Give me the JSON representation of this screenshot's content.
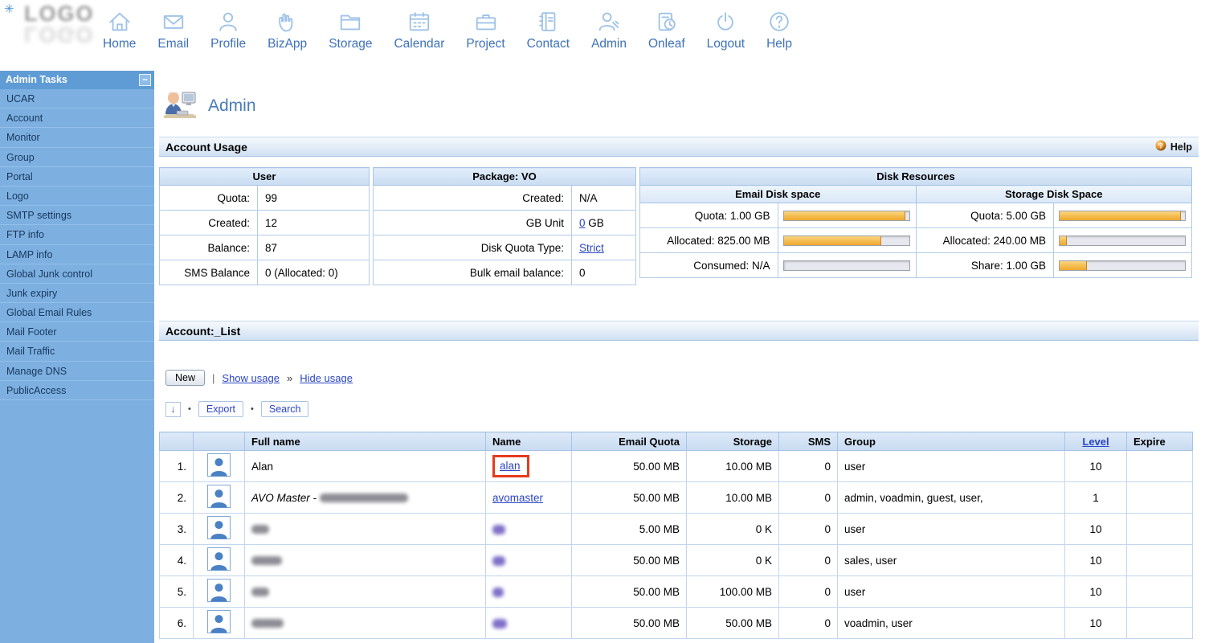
{
  "branding": {
    "mark": "✳",
    "logo_text": "LOGO"
  },
  "topnav": {
    "items": [
      {
        "label": "Home",
        "icon": "home-icon"
      },
      {
        "label": "Email",
        "icon": "email-icon"
      },
      {
        "label": "Profile",
        "icon": "profile-icon"
      },
      {
        "label": "BizApp",
        "icon": "bizapp-icon"
      },
      {
        "label": "Storage",
        "icon": "storage-icon"
      },
      {
        "label": "Calendar",
        "icon": "calendar-icon"
      },
      {
        "label": "Project",
        "icon": "project-icon"
      },
      {
        "label": "Contact",
        "icon": "contact-icon"
      },
      {
        "label": "Admin",
        "icon": "admin-icon"
      },
      {
        "label": "Onleaf",
        "icon": "onleaf-icon"
      },
      {
        "label": "Logout",
        "icon": "logout-icon"
      },
      {
        "label": "Help",
        "icon": "help-icon"
      }
    ]
  },
  "sidebar": {
    "title": "Admin Tasks",
    "collapse_label": "−",
    "items": [
      "UCAR",
      "Account",
      "Monitor",
      "Group",
      "Portal",
      "Logo",
      "SMTP settings",
      "FTP info",
      "LAMP info",
      "Global Junk control",
      "Junk expiry",
      "Global Email Rules",
      "Mail Footer",
      "Mail Traffic",
      "Manage DNS",
      "PublicAccess"
    ]
  },
  "page": {
    "title": "Admin",
    "section_usage": "Account Usage",
    "help_label": "Help",
    "section_list": "Account:_List"
  },
  "usage": {
    "user": {
      "header": "User",
      "rows": [
        {
          "label": "Quota:",
          "value": "99"
        },
        {
          "label": "Created:",
          "value": "12"
        },
        {
          "label": "Balance:",
          "value": "87"
        },
        {
          "label": "SMS Balance",
          "value": "0 (Allocated: 0)"
        }
      ]
    },
    "package": {
      "header": "Package: VO",
      "rows": [
        {
          "label": "Created:",
          "value": "N/A"
        },
        {
          "label": "GB Unit",
          "link": "0",
          "suffix": " GB"
        },
        {
          "label": "Disk Quota Type:",
          "link": "Strict"
        },
        {
          "label": "Bulk email balance:",
          "value": "0"
        }
      ]
    },
    "disk": {
      "header": "Disk Resources",
      "email": {
        "header": "Email Disk space",
        "rows": [
          {
            "label": "Quota: 1.00 GB",
            "fill_pct": 97
          },
          {
            "label": "Allocated: 825.00 MB",
            "fill_pct": 78
          },
          {
            "label": "Consumed: N/A",
            "fill_pct": 0
          }
        ]
      },
      "storage": {
        "header": "Storage Disk Space",
        "rows": [
          {
            "label": "Quota: 5.00 GB",
            "fill_pct": 97
          },
          {
            "label": "Allocated: 240.00 MB",
            "fill_pct": 6
          },
          {
            "label": "Share: 1.00 GB",
            "fill_pct": 22
          }
        ]
      }
    }
  },
  "toolbar": {
    "new_label": "New",
    "separator": "|",
    "show_usage": "Show usage",
    "chevron": "»",
    "hide_usage": "Hide usage",
    "sort_icon": "↓",
    "dot": "•",
    "export_label": "Export",
    "search_label": "Search"
  },
  "table": {
    "headers": [
      "",
      "",
      "Full name",
      "Name",
      "Email Quota",
      "Storage",
      "SMS",
      "Group",
      "Level",
      "Expire"
    ],
    "rows": [
      {
        "num": "1.",
        "full_name": "Alan",
        "name": "alan",
        "highlight": true,
        "email_quota": "50.00 MB",
        "storage": "10.00 MB",
        "sms": "0",
        "group": "user",
        "level": "10",
        "expire": ""
      },
      {
        "num": "2.",
        "full_name": "AVO Master - ",
        "full_name_italic": true,
        "full_name_blur": 110,
        "name": "avomaster",
        "email_quota": "50.00 MB",
        "storage": "10.00 MB",
        "sms": "0",
        "group": "admin, voadmin, guest, user,",
        "level": "1",
        "expire": ""
      },
      {
        "num": "3.",
        "full_name_blur": 22,
        "name_blur": 16,
        "email_quota": "5.00 MB",
        "storage": "0 K",
        "sms": "0",
        "group": "user",
        "level": "10",
        "expire": ""
      },
      {
        "num": "4.",
        "full_name_blur": 38,
        "name_blur": 16,
        "email_quota": "50.00 MB",
        "storage": "0 K",
        "sms": "0",
        "group": "sales, user",
        "level": "10",
        "expire": ""
      },
      {
        "num": "5.",
        "full_name_blur": 22,
        "name_blur": 14,
        "email_quota": "50.00 MB",
        "storage": "100.00 MB",
        "sms": "0",
        "group": "user",
        "level": "10",
        "expire": ""
      },
      {
        "num": "6.",
        "full_name_blur": 40,
        "name_blur": 18,
        "email_quota": "50.00 MB",
        "storage": "50.00 MB",
        "sms": "0",
        "group": "voadmin, user",
        "level": "10",
        "expire": ""
      }
    ]
  }
}
